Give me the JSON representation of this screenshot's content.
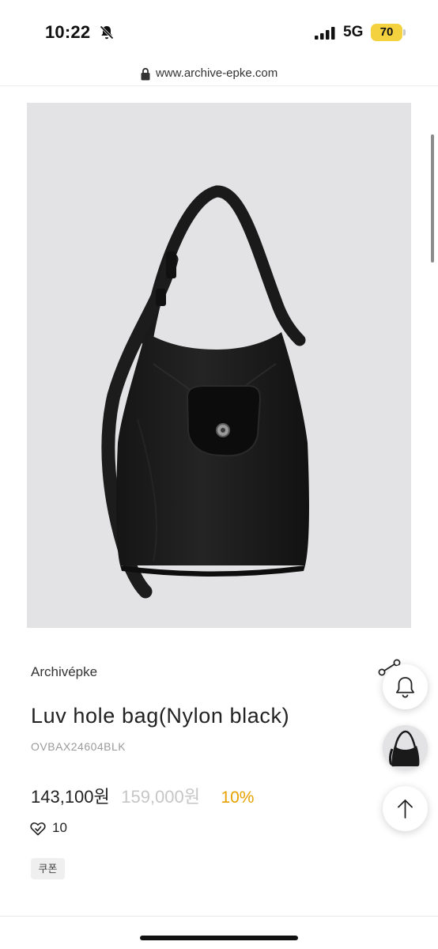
{
  "status_bar": {
    "time": "10:22",
    "network": "5G",
    "battery": "70",
    "icons": [
      "bell-slash-icon",
      "cellular-signal-icon",
      "battery-icon"
    ],
    "battery_color": "#f4d23f"
  },
  "browser": {
    "url": "www.archive-epke.com",
    "icons": [
      "lock-icon"
    ]
  },
  "product": {
    "image_alt": "black nylon hobo shoulder bag",
    "brand": "Archivépke",
    "title": "Luv hole bag(Nylon black)",
    "sku": "OVBAX24604BLK",
    "price": "143,100원",
    "original_price": "159,000원",
    "discount": "10%",
    "like_count": "10",
    "coupon_label": "쿠폰"
  },
  "floating_actions": {
    "icons": [
      "share-icon",
      "bell-icon",
      "recent-product-thumbnail",
      "arrow-up-icon"
    ]
  },
  "colors": {
    "discount": "#e7a100",
    "original_price": "#c6c6c6",
    "image_bg": "#e3e3e5"
  }
}
